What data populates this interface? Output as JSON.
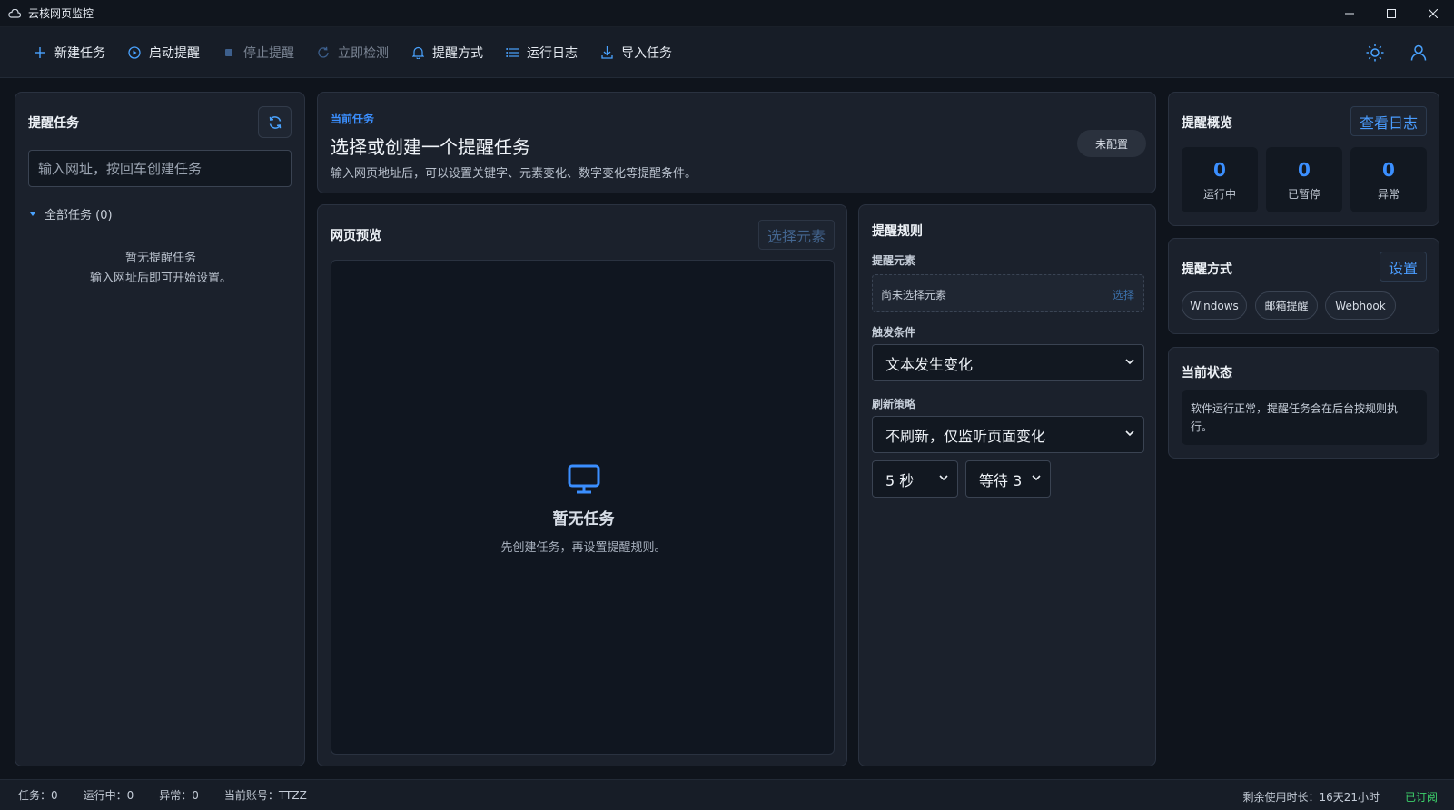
{
  "window": {
    "title": "云核网页监控",
    "minimize_icon": "minimize-icon",
    "maximize_icon": "maximize-icon",
    "close_icon": "close-icon"
  },
  "toolbar": {
    "items": [
      {
        "label": "新建任务",
        "icon": "plus-icon",
        "disabled": false
      },
      {
        "label": "启动提醒",
        "icon": "play-circle-icon",
        "disabled": false
      },
      {
        "label": "停止提醒",
        "icon": "stop-icon",
        "disabled": true
      },
      {
        "label": "立即检测",
        "icon": "refresh-icon",
        "disabled": true
      },
      {
        "label": "提醒方式",
        "icon": "bell-icon",
        "disabled": false
      },
      {
        "label": "运行日志",
        "icon": "list-icon",
        "disabled": false
      },
      {
        "label": "导入任务",
        "icon": "download-icon",
        "disabled": false
      }
    ],
    "theme_icon": "sun-icon",
    "user_icon": "user-icon"
  },
  "left": {
    "title": "提醒任务",
    "url_placeholder": "输入网址，按回车创建任务",
    "tree_label": "全部任务 (0)",
    "empty_line1": "暂无提醒任务",
    "empty_line2": "输入网址后即可开始设置。"
  },
  "current": {
    "label": "当前任务",
    "title": "选择或创建一个提醒任务",
    "desc": "输入网页地址后，可以设置关键字、元素变化、数字变化等提醒条件。",
    "badge": "未配置"
  },
  "preview": {
    "title": "网页预览",
    "select_button": "选择元素",
    "empty_title": "暂无任务",
    "empty_desc": "先创建任务，再设置提醒规则。"
  },
  "rules": {
    "title": "提醒规则",
    "element_label": "提醒元素",
    "element_placeholder": "尚未选择元素",
    "element_select": "选择",
    "trigger_label": "触发条件",
    "trigger_value": "文本发生变化",
    "refresh_label": "刷新策略",
    "refresh_value": "不刷新，仅监听页面变化",
    "interval_value": "5 秒",
    "wait_value": "等待 3"
  },
  "overview": {
    "title": "提醒概览",
    "log_button": "查看日志",
    "stats": [
      {
        "value": "0",
        "label": "运行中"
      },
      {
        "value": "0",
        "label": "已暂停"
      },
      {
        "value": "0",
        "label": "异常"
      }
    ]
  },
  "method": {
    "title": "提醒方式",
    "settings_button": "设置",
    "chips": [
      "Windows",
      "邮箱提醒",
      "Webhook"
    ]
  },
  "status": {
    "title": "当前状态",
    "text": "软件运行正常，提醒任务会在后台按规则执行。"
  },
  "statusbar": {
    "tasks": "任务：0",
    "running": "运行中：0",
    "errors": "异常：0",
    "account": "当前账号：TTZZ",
    "remaining": "剩余使用时长：16天21小时",
    "subscribed": "已订阅"
  },
  "colors": {
    "accent": "#3b8fff",
    "background": "#0f141c",
    "panel": "#1b212c",
    "success": "#3ccf6a"
  }
}
